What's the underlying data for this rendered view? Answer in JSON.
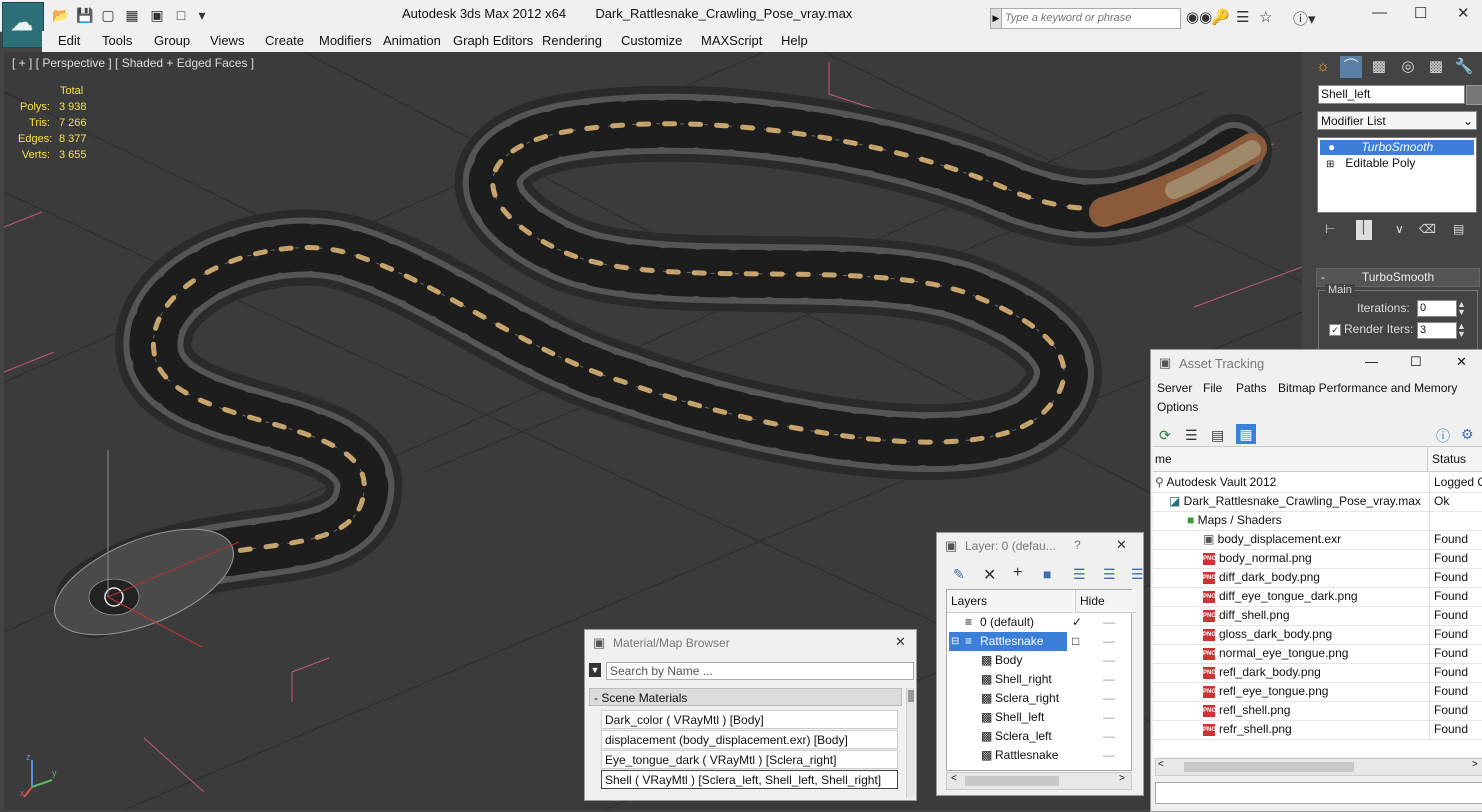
{
  "titlebar": {
    "app_name": "Autodesk 3ds Max  2012 x64",
    "file_name": "Dark_Rattlesnake_Crawling_Pose_vray.max",
    "search_placeholder": "Type a keyword or phrase"
  },
  "menu": [
    "Edit",
    "Tools",
    "Group",
    "Views",
    "Create",
    "Modifiers",
    "Animation",
    "Graph Editors",
    "Rendering",
    "Customize",
    "MAXScript",
    "Help"
  ],
  "viewport": {
    "label": "[ + ] [ Perspective ] [ Shaded + Edged Faces ]",
    "stats_header": "Total",
    "stats": [
      {
        "label": "Polys:",
        "value": "3 938"
      },
      {
        "label": "Tris:",
        "value": "7 266"
      },
      {
        "label": "Edges:",
        "value": "8 377"
      },
      {
        "label": "Verts:",
        "value": "3 655"
      }
    ],
    "axis_x": "x",
    "axis_y": "y",
    "axis_z": "z"
  },
  "command_panel": {
    "object_name": "Shell_left",
    "modifier_list": "Modifier List",
    "stack": [
      "TurboSmooth",
      "Editable Poly"
    ],
    "rollout_title": "TurboSmooth",
    "group_main": "Main",
    "iterations_label": "Iterations:",
    "iterations_value": "0",
    "render_iters_label": "Render Iters:",
    "render_iters_value": "3",
    "render_iters_checked": true
  },
  "asset_tracking": {
    "title": "Asset Tracking",
    "menus": [
      "Server",
      "File",
      "Paths",
      "Bitmap Performance and Memory",
      "Options"
    ],
    "col_name": "me",
    "col_status": "Status",
    "rows": [
      {
        "name": "Autodesk Vault 2012",
        "status": "Logged O",
        "kind": "vault"
      },
      {
        "name": "Dark_Rattlesnake_Crawling_Pose_vray.max",
        "status": "Ok",
        "kind": "max"
      },
      {
        "name": "Maps / Shaders",
        "status": "",
        "kind": "folder"
      },
      {
        "name": "body_displacement.exr",
        "status": "Found",
        "kind": "exr"
      },
      {
        "name": "body_normal.png",
        "status": "Found",
        "kind": "png"
      },
      {
        "name": "diff_dark_body.png",
        "status": "Found",
        "kind": "png"
      },
      {
        "name": "diff_eye_tongue_dark.png",
        "status": "Found",
        "kind": "png"
      },
      {
        "name": "diff_shell.png",
        "status": "Found",
        "kind": "png"
      },
      {
        "name": "gloss_dark_body.png",
        "status": "Found",
        "kind": "png"
      },
      {
        "name": "normal_eye_tongue.png",
        "status": "Found",
        "kind": "png"
      },
      {
        "name": "refl_dark_body.png",
        "status": "Found",
        "kind": "png"
      },
      {
        "name": "refl_eye_tongue.png",
        "status": "Found",
        "kind": "png"
      },
      {
        "name": "refl_shell.png",
        "status": "Found",
        "kind": "png"
      },
      {
        "name": "refr_shell.png",
        "status": "Found",
        "kind": "png"
      }
    ]
  },
  "layer_window": {
    "title": "Layer: 0 (defau...",
    "help": "?",
    "col_layers": "Layers",
    "col_hide": "Hide",
    "rows": [
      "0 (default)",
      "Rattlesnake",
      "Body",
      "Shell_right",
      "Sclera_right",
      "Shell_left",
      "Sclera_left",
      "Rattlesnake"
    ]
  },
  "material_browser": {
    "title": "Material/Map Browser",
    "search_placeholder": "Search by Name ...",
    "group": "- Scene Materials",
    "items": [
      "Dark_color  ( VRayMtl )  [Body]",
      "displacement (body_displacement.exr) [Body]",
      "Eye_tongue_dark  ( VRayMtl )  [Sclera_right]",
      "Shell  ( VRayMtl )  [Sclera_left, Shell_left, Shell_right]"
    ]
  },
  "colors": {
    "stats_yellow": "#f7e04a",
    "selection_blue": "#3b7fd8",
    "viewport_bg": "#3b3b3b"
  }
}
